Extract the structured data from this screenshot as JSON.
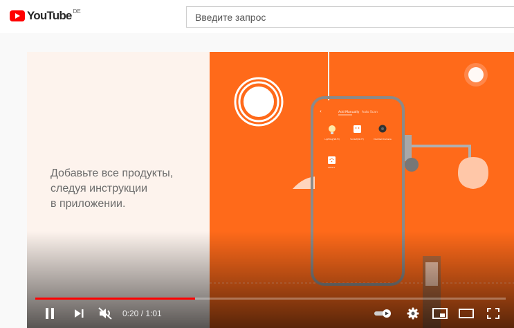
{
  "header": {
    "logo_text": "YouTube",
    "logo_region": "DE",
    "search_placeholder": "Введите запрос"
  },
  "video": {
    "caption": "Добавьте все продукты,\nследуя инструкции\nв приложении.",
    "phone_screen": {
      "tabs": [
        "Add Manually",
        "Auto Scan"
      ],
      "devices": [
        "Lighting(Wi-Fi)",
        "Socket(Wi-Fi)",
        "Doorbell Camera",
        "Others"
      ]
    }
  },
  "player": {
    "current_time": "0:20",
    "duration": "1:01",
    "progress_fraction": 0.34,
    "accent_color": "#ff0000",
    "icons": [
      "pause-icon",
      "next-icon",
      "mute-icon",
      "autoplay-toggle-icon",
      "settings-icon",
      "miniplayer-icon",
      "theater-icon",
      "fullscreen-icon"
    ]
  }
}
